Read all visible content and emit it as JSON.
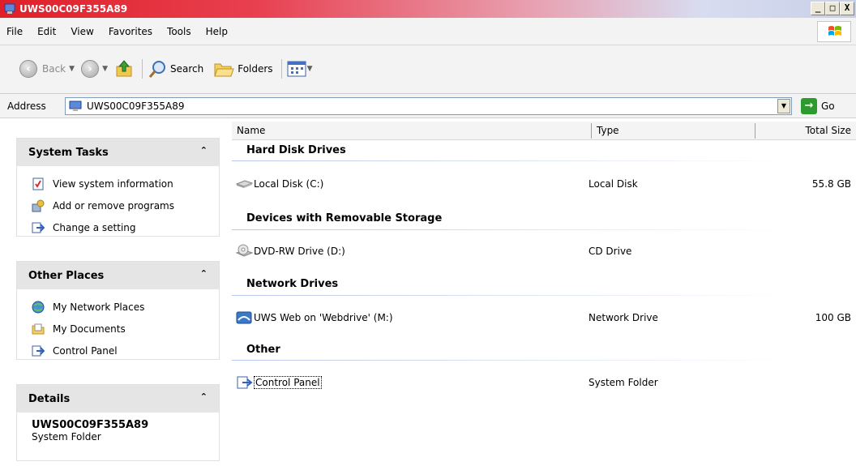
{
  "window": {
    "title": "UWS00C09F355A89",
    "minimize": "_",
    "maximize": "□",
    "close": "X"
  },
  "menu": [
    "File",
    "Edit",
    "View",
    "Favorites",
    "Tools",
    "Help"
  ],
  "toolbar": {
    "back_label": "Back",
    "search_label": "Search",
    "folders_label": "Folders"
  },
  "address": {
    "label": "Address",
    "value": "UWS00C09F355A89",
    "go_label": "Go"
  },
  "left_panel": {
    "system_tasks": {
      "title": "System Tasks",
      "items": [
        "View system information",
        "Add or remove programs",
        "Change a setting"
      ]
    },
    "other_places": {
      "title": "Other Places",
      "items": [
        "My Network Places",
        "My Documents",
        "Control Panel"
      ]
    },
    "details": {
      "title": "Details",
      "name": "UWS00C09F355A89",
      "type": "System Folder"
    }
  },
  "columns": {
    "name": "Name",
    "type": "Type",
    "size": "Total Size"
  },
  "groups": [
    {
      "title": "Hard Disk Drives",
      "items": [
        {
          "name": "Local Disk (C:)",
          "type": "Local Disk",
          "size": "55.8 GB",
          "icon": "hard-disk-icon"
        }
      ]
    },
    {
      "title": "Devices with Removable Storage",
      "items": [
        {
          "name": "DVD-RW Drive (D:)",
          "type": "CD Drive",
          "size": "",
          "icon": "dvd-drive-icon"
        }
      ]
    },
    {
      "title": "Network Drives",
      "items": [
        {
          "name": "UWS Web on 'Webdrive' (M:)",
          "type": "Network Drive",
          "size": "100 GB",
          "icon": "network-drive-icon"
        }
      ]
    },
    {
      "title": "Other",
      "items": [
        {
          "name": "Control Panel",
          "type": "System Folder",
          "size": "",
          "icon": "control-panel-icon"
        }
      ]
    }
  ]
}
